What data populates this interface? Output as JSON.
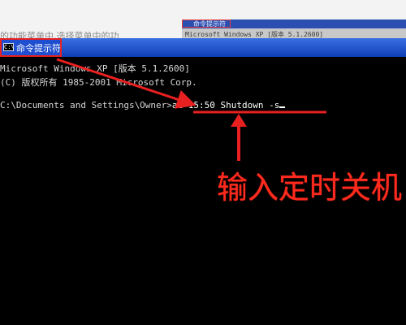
{
  "background": {
    "doc_text": "的功能菜单中,选择菜单中的功",
    "mini_window_title": "命令提示符",
    "mini_window_line": "Microsoft Windows XP [版本 5.1.2600]"
  },
  "window": {
    "title": "命令提示符",
    "icon_label": "C:\\"
  },
  "console": {
    "line1": "Microsoft Windows XP [版本 5.1.2600]",
    "line2": "(C) 版权所有 1985-2001 Microsoft Corp.",
    "prompt": "C:\\Documents and Settings\\Owner>",
    "command": "at 15:50 Shutdown -s"
  },
  "annotation": {
    "label": "输入定时关机",
    "color": "#ff2a1e"
  },
  "colors": {
    "console_bg": "#000000",
    "console_text": "#d8d8d8",
    "titlebar": "#1f4fd0",
    "highlight": "#e82020"
  }
}
